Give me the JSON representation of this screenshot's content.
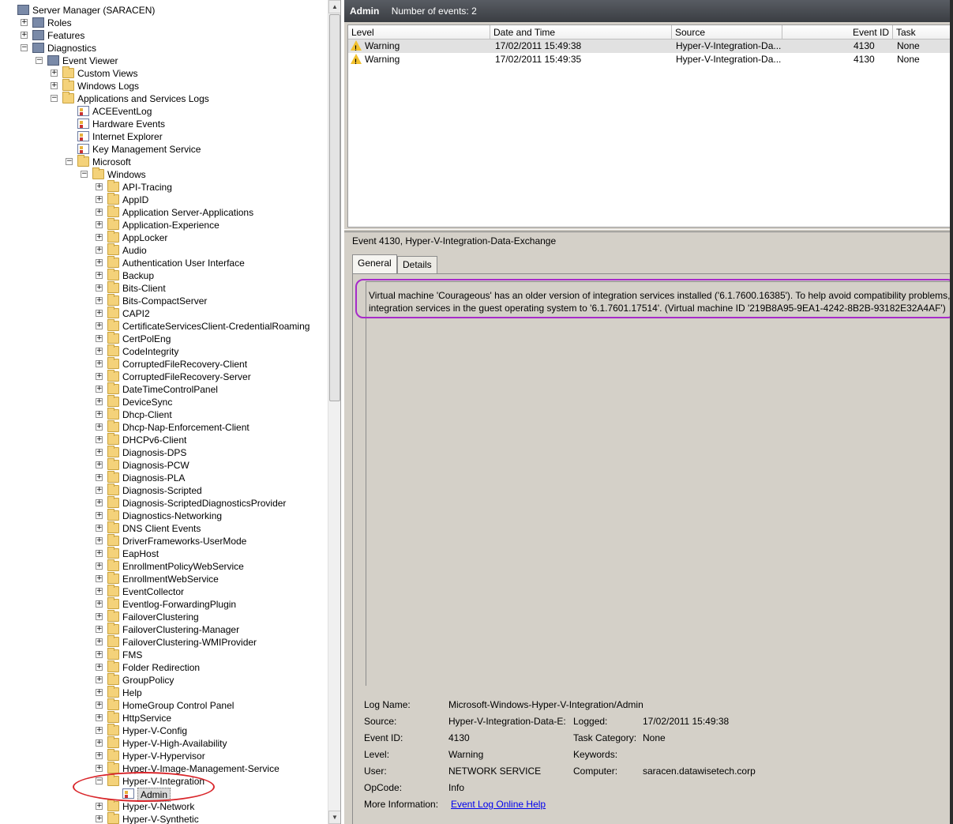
{
  "tree": {
    "items": [
      {
        "label": "Server Manager (SARACEN)",
        "depth": 0,
        "exp": "",
        "icon": "srv"
      },
      {
        "label": "Roles",
        "depth": 1,
        "exp": "+",
        "icon": "srv"
      },
      {
        "label": "Features",
        "depth": 1,
        "exp": "+",
        "icon": "srv"
      },
      {
        "label": "Diagnostics",
        "depth": 1,
        "exp": "−",
        "icon": "srv"
      },
      {
        "label": "Event Viewer",
        "depth": 2,
        "exp": "−",
        "icon": "srv"
      },
      {
        "label": "Custom Views",
        "depth": 3,
        "exp": "+",
        "icon": "folder"
      },
      {
        "label": "Windows Logs",
        "depth": 3,
        "exp": "+",
        "icon": "folder"
      },
      {
        "label": "Applications and Services Logs",
        "depth": 3,
        "exp": "−",
        "icon": "folder"
      },
      {
        "label": "ACEEventLog",
        "depth": 4,
        "exp": "",
        "icon": "log"
      },
      {
        "label": "Hardware Events",
        "depth": 4,
        "exp": "",
        "icon": "log"
      },
      {
        "label": "Internet Explorer",
        "depth": 4,
        "exp": "",
        "icon": "log"
      },
      {
        "label": "Key Management Service",
        "depth": 4,
        "exp": "",
        "icon": "log"
      },
      {
        "label": "Microsoft",
        "depth": 4,
        "exp": "−",
        "icon": "folder",
        "expOffset": -19
      },
      {
        "label": "Windows",
        "depth": 5,
        "exp": "−",
        "icon": "folder",
        "expOffset": -19
      },
      {
        "label": "API-Tracing",
        "depth": 6,
        "exp": "+",
        "icon": "folder"
      },
      {
        "label": "AppID",
        "depth": 6,
        "exp": "+",
        "icon": "folder"
      },
      {
        "label": "Application Server-Applications",
        "depth": 6,
        "exp": "+",
        "icon": "folder"
      },
      {
        "label": "Application-Experience",
        "depth": 6,
        "exp": "+",
        "icon": "folder"
      },
      {
        "label": "AppLocker",
        "depth": 6,
        "exp": "+",
        "icon": "folder"
      },
      {
        "label": "Audio",
        "depth": 6,
        "exp": "+",
        "icon": "folder"
      },
      {
        "label": "Authentication User Interface",
        "depth": 6,
        "exp": "+",
        "icon": "folder"
      },
      {
        "label": "Backup",
        "depth": 6,
        "exp": "+",
        "icon": "folder"
      },
      {
        "label": "Bits-Client",
        "depth": 6,
        "exp": "+",
        "icon": "folder"
      },
      {
        "label": "Bits-CompactServer",
        "depth": 6,
        "exp": "+",
        "icon": "folder"
      },
      {
        "label": "CAPI2",
        "depth": 6,
        "exp": "+",
        "icon": "folder"
      },
      {
        "label": "CertificateServicesClient-CredentialRoaming",
        "depth": 6,
        "exp": "+",
        "icon": "folder"
      },
      {
        "label": "CertPolEng",
        "depth": 6,
        "exp": "+",
        "icon": "folder"
      },
      {
        "label": "CodeIntegrity",
        "depth": 6,
        "exp": "+",
        "icon": "folder"
      },
      {
        "label": "CorruptedFileRecovery-Client",
        "depth": 6,
        "exp": "+",
        "icon": "folder"
      },
      {
        "label": "CorruptedFileRecovery-Server",
        "depth": 6,
        "exp": "+",
        "icon": "folder"
      },
      {
        "label": "DateTimeControlPanel",
        "depth": 6,
        "exp": "+",
        "icon": "folder"
      },
      {
        "label": "DeviceSync",
        "depth": 6,
        "exp": "+",
        "icon": "folder"
      },
      {
        "label": "Dhcp-Client",
        "depth": 6,
        "exp": "+",
        "icon": "folder"
      },
      {
        "label": "Dhcp-Nap-Enforcement-Client",
        "depth": 6,
        "exp": "+",
        "icon": "folder"
      },
      {
        "label": "DHCPv6-Client",
        "depth": 6,
        "exp": "+",
        "icon": "folder"
      },
      {
        "label": "Diagnosis-DPS",
        "depth": 6,
        "exp": "+",
        "icon": "folder"
      },
      {
        "label": "Diagnosis-PCW",
        "depth": 6,
        "exp": "+",
        "icon": "folder"
      },
      {
        "label": "Diagnosis-PLA",
        "depth": 6,
        "exp": "+",
        "icon": "folder"
      },
      {
        "label": "Diagnosis-Scripted",
        "depth": 6,
        "exp": "+",
        "icon": "folder"
      },
      {
        "label": "Diagnosis-ScriptedDiagnosticsProvider",
        "depth": 6,
        "exp": "+",
        "icon": "folder"
      },
      {
        "label": "Diagnostics-Networking",
        "depth": 6,
        "exp": "+",
        "icon": "folder"
      },
      {
        "label": "DNS Client Events",
        "depth": 6,
        "exp": "+",
        "icon": "folder"
      },
      {
        "label": "DriverFrameworks-UserMode",
        "depth": 6,
        "exp": "+",
        "icon": "folder"
      },
      {
        "label": "EapHost",
        "depth": 6,
        "exp": "+",
        "icon": "folder"
      },
      {
        "label": "EnrollmentPolicyWebService",
        "depth": 6,
        "exp": "+",
        "icon": "folder"
      },
      {
        "label": "EnrollmentWebService",
        "depth": 6,
        "exp": "+",
        "icon": "folder"
      },
      {
        "label": "EventCollector",
        "depth": 6,
        "exp": "+",
        "icon": "folder"
      },
      {
        "label": "Eventlog-ForwardingPlugin",
        "depth": 6,
        "exp": "+",
        "icon": "folder"
      },
      {
        "label": "FailoverClustering",
        "depth": 6,
        "exp": "+",
        "icon": "folder"
      },
      {
        "label": "FailoverClustering-Manager",
        "depth": 6,
        "exp": "+",
        "icon": "folder"
      },
      {
        "label": "FailoverClustering-WMIProvider",
        "depth": 6,
        "exp": "+",
        "icon": "folder"
      },
      {
        "label": "FMS",
        "depth": 6,
        "exp": "+",
        "icon": "folder"
      },
      {
        "label": "Folder Redirection",
        "depth": 6,
        "exp": "+",
        "icon": "folder"
      },
      {
        "label": "GroupPolicy",
        "depth": 6,
        "exp": "+",
        "icon": "folder"
      },
      {
        "label": "Help",
        "depth": 6,
        "exp": "+",
        "icon": "folder"
      },
      {
        "label": "HomeGroup Control Panel",
        "depth": 6,
        "exp": "+",
        "icon": "folder"
      },
      {
        "label": "HttpService",
        "depth": 6,
        "exp": "+",
        "icon": "folder"
      },
      {
        "label": "Hyper-V-Config",
        "depth": 6,
        "exp": "+",
        "icon": "folder"
      },
      {
        "label": "Hyper-V-High-Availability",
        "depth": 6,
        "exp": "+",
        "icon": "folder"
      },
      {
        "label": "Hyper-V-Hypervisor",
        "depth": 6,
        "exp": "+",
        "icon": "folder"
      },
      {
        "label": "Hyper-V-Image-Management-Service",
        "depth": 6,
        "exp": "+",
        "icon": "folder"
      },
      {
        "label": "Hyper-V-Integration",
        "depth": 6,
        "exp": "−",
        "icon": "folder"
      },
      {
        "label": "Admin",
        "depth": 7,
        "exp": "",
        "icon": "log",
        "selected": true
      },
      {
        "label": "Hyper-V-Network",
        "depth": 6,
        "exp": "+",
        "icon": "folder"
      },
      {
        "label": "Hyper-V-Synthetic",
        "depth": 6,
        "exp": "+",
        "icon": "folder"
      }
    ]
  },
  "header": {
    "title": "Admin",
    "count": "Number of events: 2"
  },
  "grid": {
    "columns": [
      "Level",
      "Date and Time",
      "Source",
      "Event ID",
      "Task Category"
    ],
    "rows": [
      {
        "level": "Warning",
        "date": "17/02/2011 15:49:38",
        "source": "Hyper-V-Integration-Da...",
        "id": "4130",
        "task": "None"
      },
      {
        "level": "Warning",
        "date": "17/02/2011 15:49:35",
        "source": "Hyper-V-Integration-Da...",
        "id": "4130",
        "task": "None"
      }
    ]
  },
  "detail": {
    "title": "Event 4130, Hyper-V-Integration-Data-Exchange",
    "tabs": [
      "General",
      "Details"
    ],
    "description_line1": "Virtual machine 'Courageous' has an older version of integration services installed ('6.1.7600.16385'). To help avoid compatibility problems, u",
    "description_line2": "integration services in the guest operating system to '6.1.7601.17514'. (Virtual machine ID '219B8A95-9EA1-4242-8B2B-93182E32A4AF')",
    "labels": {
      "log_name": "Log Name:",
      "source": "Source:",
      "event_id": "Event ID:",
      "level": "Level:",
      "user": "User:",
      "opcode": "OpCode:",
      "more_info": "More Information:",
      "logged": "Logged:",
      "task_category": "Task Category:",
      "keywords": "Keywords:",
      "computer": "Computer:"
    },
    "values": {
      "log_name": "Microsoft-Windows-Hyper-V-Integration/Admin",
      "source": "Hyper-V-Integration-Data-E:",
      "event_id": "4130",
      "level": "Warning",
      "user": "NETWORK SERVICE",
      "opcode": "Info",
      "more_info": "Event Log Online Help",
      "logged": "17/02/2011 15:49:38",
      "task_category": "None",
      "keywords": "",
      "computer": "saracen.datawisetech.corp"
    }
  }
}
